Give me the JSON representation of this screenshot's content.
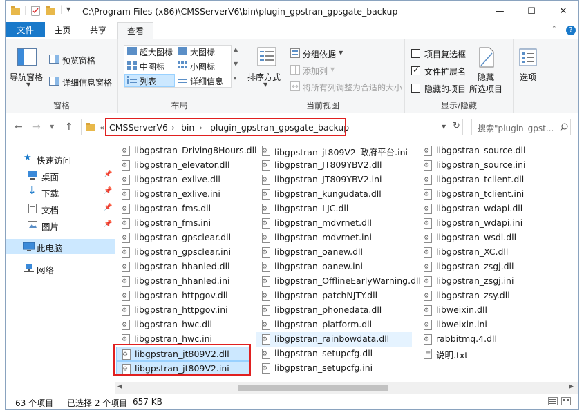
{
  "title": "C:\\Program Files (x86)\\CMSServerV6\\bin\\plugin_gpstran_gpsgate_backup",
  "window_controls": {
    "minimize": "—",
    "maximize": "☐",
    "close": "✕"
  },
  "tabs": [
    "文件",
    "主页",
    "共享",
    "查看"
  ],
  "help_icon": "?",
  "ribbon": {
    "panes": {
      "label": "窗格",
      "nav_pane": "导航窗格",
      "preview_pane": "预览窗格",
      "details_pane": "详细信息窗格"
    },
    "layout": {
      "label": "布局",
      "xl_icons": "超大图标",
      "l_icons": "大图标",
      "m_icons": "中图标",
      "s_icons": "小图标",
      "list": "列表",
      "details": "详细信息"
    },
    "current_view": {
      "label": "当前视图",
      "sort_by": "排序方式",
      "group_by": "分组依据",
      "add_columns": "添加列",
      "size_all_columns": "将所有列调整为合适的大小"
    },
    "show_hide": {
      "label": "显示/隐藏",
      "item_checkboxes": "项目复选框",
      "file_extensions": "文件扩展名",
      "hidden_items": "隐藏的项目",
      "hide_selected": "隐藏",
      "hide_selected_2": "所选项目",
      "options": "选项"
    }
  },
  "breadcrumb": {
    "prefix": "«",
    "items": [
      "CMSServerV6",
      "bin",
      "plugin_gpstran_gpsgate_backup"
    ]
  },
  "search_placeholder": "搜索\"plugin_gpst...",
  "nav": {
    "quick_access": "快速访问",
    "desktop": "桌面",
    "downloads": "下载",
    "documents": "文档",
    "pictures": "图片",
    "this_pc": "此电脑",
    "network": "网络"
  },
  "files": {
    "col1": [
      "libgpstran_Driving8Hours.dll",
      "libgpstran_elevator.dll",
      "libgpstran_exlive.dll",
      "libgpstran_exlive.ini",
      "libgpstran_fms.dll",
      "libgpstran_fms.ini",
      "libgpstran_gpsclear.dll",
      "libgpstran_gpsclear.ini",
      "libgpstran_hhanled.dll",
      "libgpstran_hhanled.ini",
      "libgpstran_httpgov.dll",
      "libgpstran_httpgov.ini",
      "libgpstran_hwc.dll",
      "libgpstran_hwc.ini",
      "libgpstran_jt809V2.dll",
      "libgpstran_jt809V2.ini"
    ],
    "col2": [
      "libgpstran_jt809V2_政府平台.ini",
      "libgpstran_JT809YBV2.dll",
      "libgpstran_JT809YBV2.ini",
      "libgpstran_kungudata.dll",
      "libgpstran_LJC.dll",
      "libgpstran_mdvrnet.dll",
      "libgpstran_mdvrnet.ini",
      "libgpstran_oanew.dll",
      "libgpstran_oanew.ini",
      "libgpstran_OfflineEarlyWarning.dll",
      "libgpstran_patchNJTY.dll",
      "libgpstran_phonedata.dll",
      "libgpstran_platform.dll",
      "libgpstran_rainbowdata.dll",
      "libgpstran_setupcfg.dll",
      "libgpstran_setupcfg.ini"
    ],
    "col3": [
      "libgpstran_source.dll",
      "libgpstran_source.ini",
      "libgpstran_tclient.dll",
      "libgpstran_tclient.ini",
      "libgpstran_wdapi.dll",
      "libgpstran_wdapi.ini",
      "libgpstran_wsdl.dll",
      "libgpstran_XC.dll",
      "libgpstran_zsgj.dll",
      "libgpstran_zsgj.ini",
      "libgpstran_zsy.dll",
      "libweixin.dll",
      "libweixin.ini",
      "rabbitmq.4.dll",
      "说明.txt"
    ]
  },
  "status": {
    "count": "63 个项目",
    "selected": "已选择 2 个项目",
    "size": "657 KB"
  },
  "accent_color": "#1979ca",
  "highlight_color": "#e02020"
}
